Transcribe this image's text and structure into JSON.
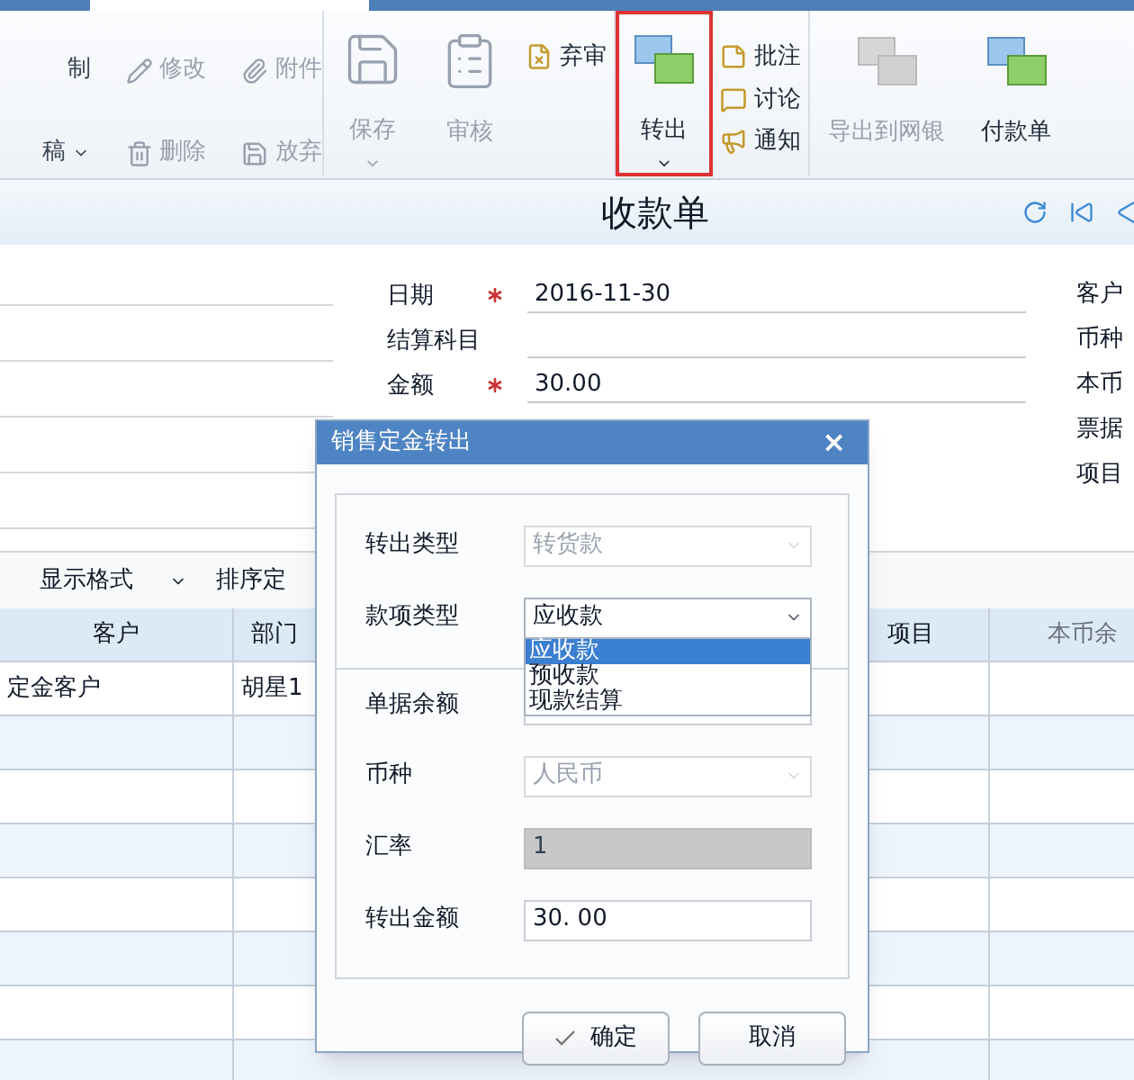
{
  "toolbar": [
    {
      "kind": "grid",
      "items": [
        {
          "label": "制",
          "disabled": false,
          "dropdown": false
        },
        {
          "label": "修改",
          "disabled": true,
          "dropdown": false
        },
        {
          "label": "附件",
          "disabled": true,
          "dropdown": false
        },
        {
          "label": "稿",
          "disabled": false,
          "dropdown": true
        },
        {
          "label": "删除",
          "disabled": true,
          "dropdown": false
        },
        {
          "label": "放弃",
          "disabled": true,
          "dropdown": false
        }
      ]
    },
    {
      "kind": "large",
      "label": "保存",
      "disabled": true,
      "dropdown": true,
      "highlighted": false
    },
    {
      "kind": "large",
      "label": "审核",
      "disabled": true,
      "dropdown": false,
      "highlighted": false
    },
    {
      "kind": "column",
      "items": [
        {
          "label": "弃审",
          "disabled": false
        }
      ]
    },
    {
      "kind": "large",
      "label": "转出",
      "disabled": false,
      "dropdown": true,
      "highlighted": true
    },
    {
      "kind": "column",
      "items": [
        {
          "label": "批注",
          "disabled": false
        },
        {
          "label": "讨论",
          "disabled": false
        },
        {
          "label": "通知",
          "disabled": false
        }
      ]
    },
    {
      "kind": "large",
      "label": "导出到网银",
      "disabled": true,
      "dropdown": false,
      "highlighted": false
    },
    {
      "kind": "large",
      "label": "付款单",
      "disabled": false,
      "dropdown": false,
      "highlighted": false
    }
  ],
  "document_title": "收款单",
  "form": {
    "fields": [
      {
        "label": "日期",
        "required": true,
        "value": "2016-11-30"
      },
      {
        "label": "结算科目",
        "required": false
      },
      {
        "label": "金额",
        "required": true,
        "value": "30.00"
      }
    ],
    "right_labels": [
      "客户",
      "币种",
      "本币",
      "票据",
      "项目"
    ]
  },
  "grid_toolbar": [
    {
      "label": "显示格式",
      "dropdown": true
    },
    {
      "label": "排序定",
      "dropdown": false
    }
  ],
  "table": {
    "columns": [
      "客户",
      "部门",
      "项目",
      "本币余"
    ],
    "rows": [
      {
        "customer": "定金客户",
        "department": "胡星1"
      }
    ]
  },
  "dialog": {
    "title": "销售定金转出",
    "close": "×",
    "fields": [
      {
        "kind": "select",
        "label": "转出类型",
        "value": "转货款",
        "disabled": true,
        "expanded": false
      },
      {
        "kind": "select",
        "label": "款项类型",
        "value": "应收款",
        "disabled": false,
        "expanded": true,
        "options": [
          {
            "label": "应收款",
            "selected": true
          },
          {
            "label": "预收款",
            "selected": false
          },
          {
            "label": "现款结算",
            "selected": false
          }
        ]
      },
      {
        "kind": "input",
        "label": "单据余额",
        "disabled": false
      },
      {
        "kind": "select",
        "label": "币种",
        "value": "人民币",
        "disabled": true,
        "expanded": false
      },
      {
        "kind": "input",
        "label": "汇率",
        "value": "1",
        "disabled": true
      },
      {
        "kind": "input",
        "label": "转出金额",
        "value": "30. 00",
        "disabled": false
      }
    ],
    "buttons": [
      {
        "label": "确定"
      },
      {
        "label": "取消"
      }
    ]
  }
}
